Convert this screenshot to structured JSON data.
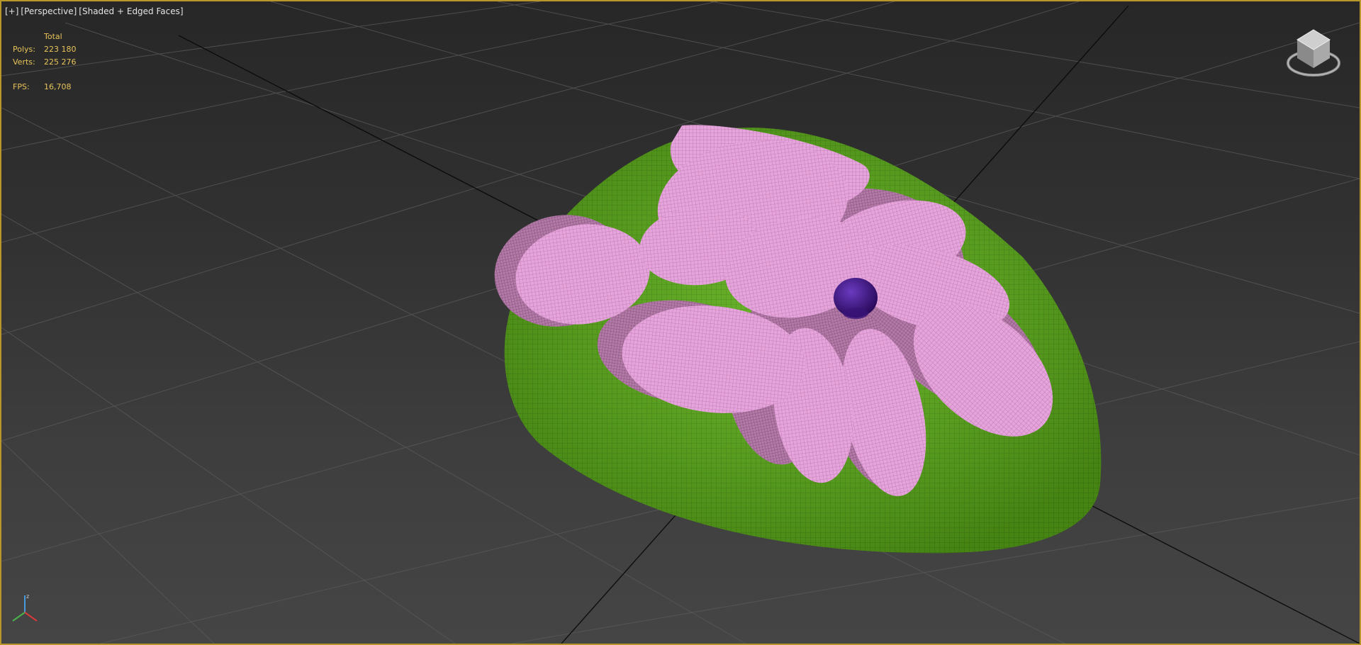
{
  "viewport": {
    "menu_label": "[+]",
    "view_label": "[Perspective]",
    "shading_label": "[Shaded + Edged Faces]"
  },
  "stats": {
    "header": "Total",
    "polys_label": "Polys:",
    "polys_value": "223 180",
    "verts_label": "Verts:",
    "verts_value": "225 276",
    "fps_label": "FPS:",
    "fps_value": "16,708"
  },
  "icons": {
    "viewcube": "viewcube-icon",
    "axis": "axis-tripod-icon"
  },
  "colors": {
    "frame": "#b8962a",
    "stats_text": "#e8c45a",
    "base_mesh": "#5aa61c",
    "petal_mesh": "#e8a3dc",
    "center_mesh": "#4a1a8c"
  }
}
